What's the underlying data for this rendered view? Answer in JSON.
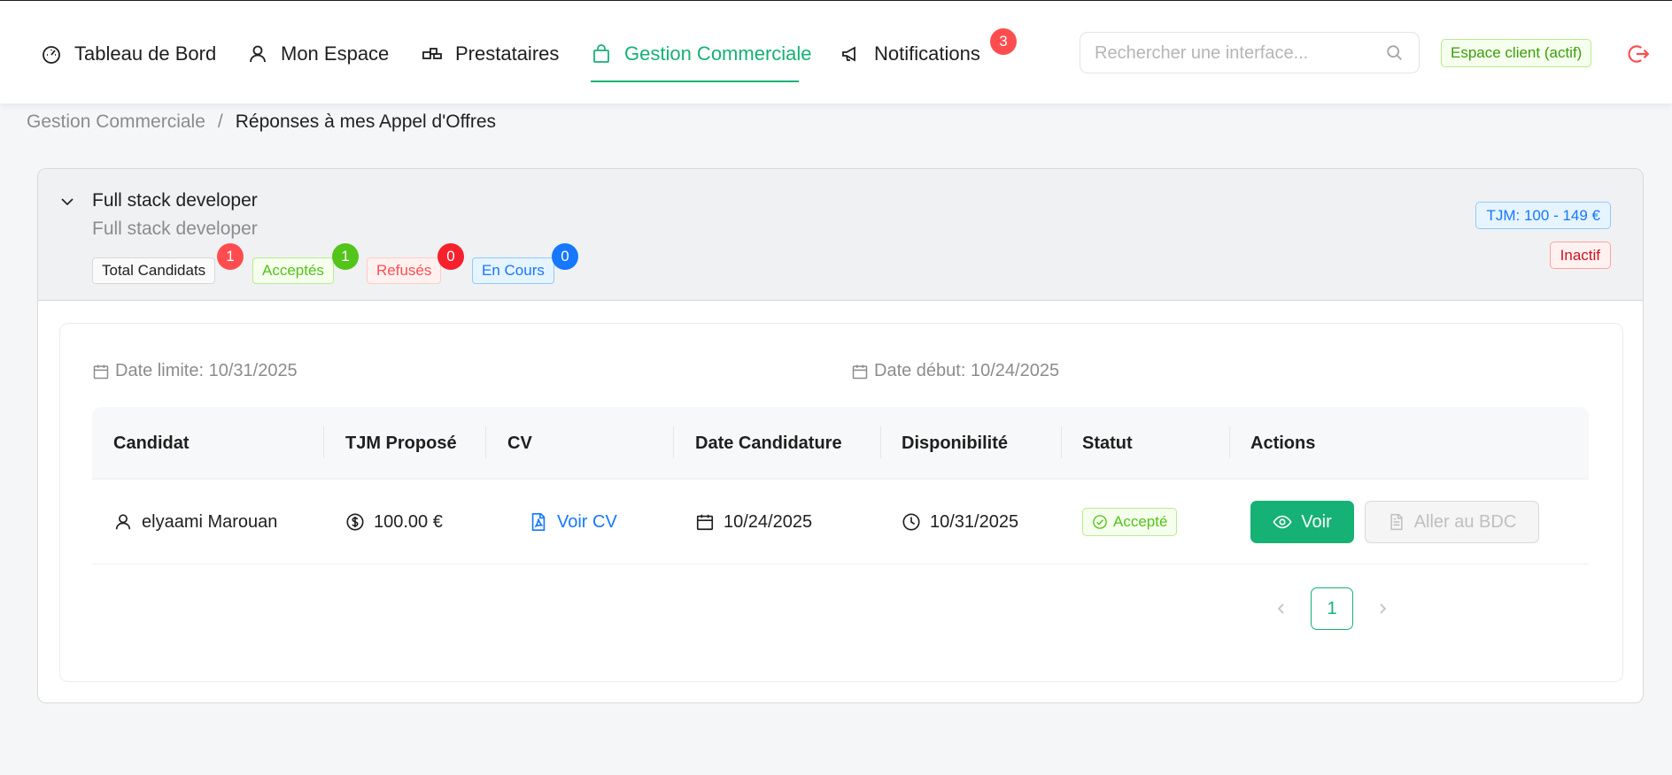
{
  "nav": {
    "items": [
      {
        "label": "Tableau de Bord",
        "icon": "dashboard-icon"
      },
      {
        "label": "Mon Espace",
        "icon": "user-icon"
      },
      {
        "label": "Prestataires",
        "icon": "team-icon"
      },
      {
        "label": "Gestion Commerciale",
        "icon": "shopping-bag-icon",
        "active": true
      },
      {
        "label": "Notifications",
        "icon": "megaphone-icon"
      }
    ],
    "notifications_count": "3",
    "search_placeholder": "Rechercher une interface...",
    "client_tag": "Espace client (actif)",
    "accent_color": "#16b174"
  },
  "breadcrumb": {
    "parent": "Gestion Commerciale",
    "separator": "/",
    "current": "Réponses à mes Appel d'Offres"
  },
  "offer": {
    "title": "Full stack developer",
    "subtitle": "Full stack developer",
    "tjm_tag": "TJM: 100 - 149 €",
    "status_tag": "Inactif",
    "stats": {
      "total_label": "Total Candidats",
      "total_count": "1",
      "accepted_label": "Acceptés",
      "accepted_count": "1",
      "refused_label": "Refusés",
      "refused_count": "0",
      "pending_label": "En Cours",
      "pending_count": "0"
    },
    "date_limit": "Date limite: 10/31/2025",
    "date_start": "Date début: 10/24/2025"
  },
  "table": {
    "headers": {
      "candidate": "Candidat",
      "tjm": "TJM Proposé",
      "cv": "CV",
      "date": "Date Candidature",
      "availability": "Disponibilité",
      "status": "Statut",
      "actions": "Actions"
    },
    "rows": [
      {
        "candidate": "elyaami Marouan",
        "tjm": "100.00 €",
        "cv": "Voir CV",
        "date": "10/24/2025",
        "availability": "10/31/2025",
        "status": "Accepté",
        "view_label": "Voir",
        "bdc_label": "Aller au BDC"
      }
    ]
  },
  "pagination": {
    "current_page": "1"
  }
}
